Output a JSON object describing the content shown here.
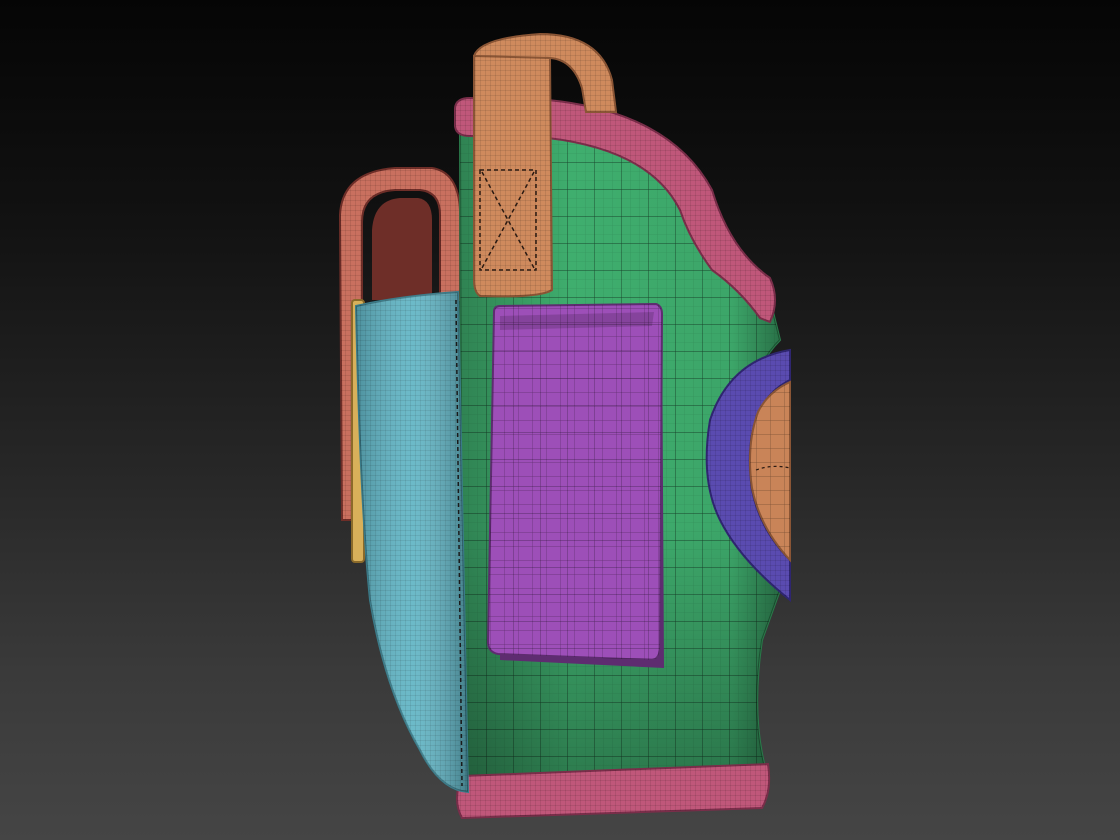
{
  "scene": {
    "subject": "holster-3d-model",
    "colors": {
      "background_top": "#050505",
      "background_bottom": "#454545",
      "body": "#3fae6e",
      "body_dark": "#2a7a4a",
      "rim": "#c0577a",
      "rim_dark": "#7a2e4a",
      "front_strap": "#cf8a5d",
      "front_strap_dark": "#8a5535",
      "rear_loop": "#c9705f",
      "rear_loop_dark": "#6e2e28",
      "side_panel": "#5fb4c4",
      "side_panel_dark": "#3a7c8a",
      "belt_clip": "#9d4fb8",
      "belt_clip_dark": "#5e2c70",
      "thumb_ring": "#5a4bb0",
      "thumb_ring_dark": "#2f2670",
      "thumb_pad": "#c98458",
      "yellow_strip": "#d8b05a",
      "wire": "#1c1c1c"
    }
  }
}
